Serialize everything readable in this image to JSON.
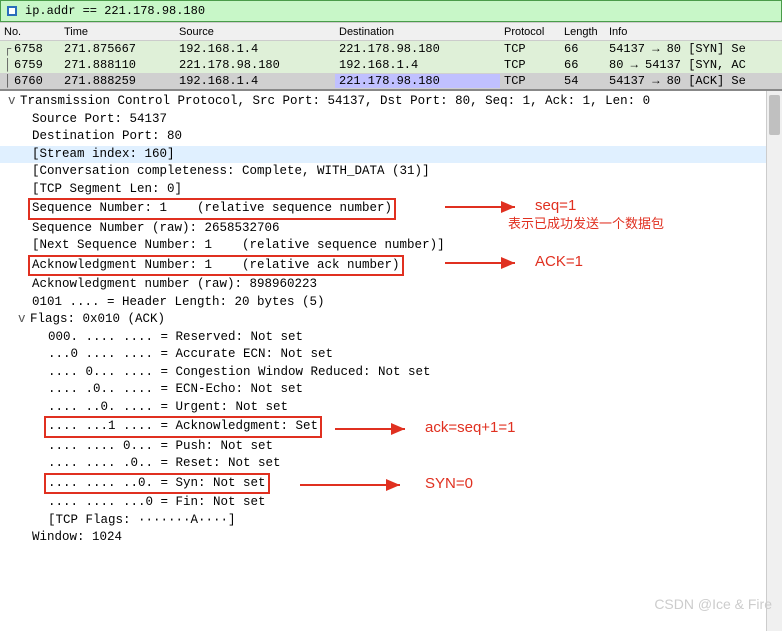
{
  "filter": {
    "value": "ip.addr == 221.178.98.180"
  },
  "columns": {
    "no": "No.",
    "time": "Time",
    "src": "Source",
    "dst": "Destination",
    "proto": "Protocol",
    "len": "Length",
    "info": "Info"
  },
  "rows": [
    {
      "no": "6758",
      "time": "271.875667",
      "src": "192.168.1.4",
      "dst": "221.178.98.180",
      "proto": "TCP",
      "len": "66",
      "info": "54137 → 80 [SYN] Se"
    },
    {
      "no": "6759",
      "time": "271.888110",
      "src": "221.178.98.180",
      "dst": "192.168.1.4",
      "proto": "TCP",
      "len": "66",
      "info": "80 → 54137 [SYN, AC"
    },
    {
      "no": "6760",
      "time": "271.888259",
      "src": "192.168.1.4",
      "dst": "221.178.98.180",
      "proto": "TCP",
      "len": "54",
      "info": "54137 → 80 [ACK] Se"
    }
  ],
  "tcp": {
    "header": "Transmission Control Protocol, Src Port: 54137, Dst Port: 80, Seq: 1, Ack: 1, Len: 0",
    "srcport": "Source Port: 54137",
    "dstport": "Destination Port: 80",
    "stream": "[Stream index: 160]",
    "conv": "[Conversation completeness: Complete, WITH_DATA (31)]",
    "seglen": "[TCP Segment Len: 0]",
    "seq": "Sequence Number: 1    (relative sequence number)",
    "seqraw": "Sequence Number (raw): 2658532706",
    "nextseq": "[Next Sequence Number: 1    (relative sequence number)]",
    "ack": "Acknowledgment Number: 1    (relative ack number)",
    "ackraw": "Acknowledgment number (raw): 898960223",
    "hlen": "0101 .... = Header Length: 20 bytes (5)",
    "flags_header": "Flags: 0x010 (ACK)",
    "flags": {
      "reserved": "000. .... .... = Reserved: Not set",
      "aecn": "...0 .... .... = Accurate ECN: Not set",
      "cwr": ".... 0... .... = Congestion Window Reduced: Not set",
      "ecn": ".... .0.. .... = ECN-Echo: Not set",
      "urg": ".... ..0. .... = Urgent: Not set",
      "ackf": ".... ...1 .... = Acknowledgment: Set",
      "push": ".... .... 0... = Push: Not set",
      "reset": ".... .... .0.. = Reset: Not set",
      "syn": ".... .... ..0. = Syn: Not set",
      "fin": ".... .... ...0 = Fin: Not set",
      "tcpflags": "[TCP Flags: ·······A····]"
    },
    "window": "Window: 1024"
  },
  "annotations": {
    "seq": "seq=1",
    "seq2": "表示已成功发送一个数据包",
    "ackA": "ACK=1",
    "ackf": "ack=seq+1=1",
    "syn": "SYN=0"
  },
  "watermark": "CSDN @Ice & Fire"
}
